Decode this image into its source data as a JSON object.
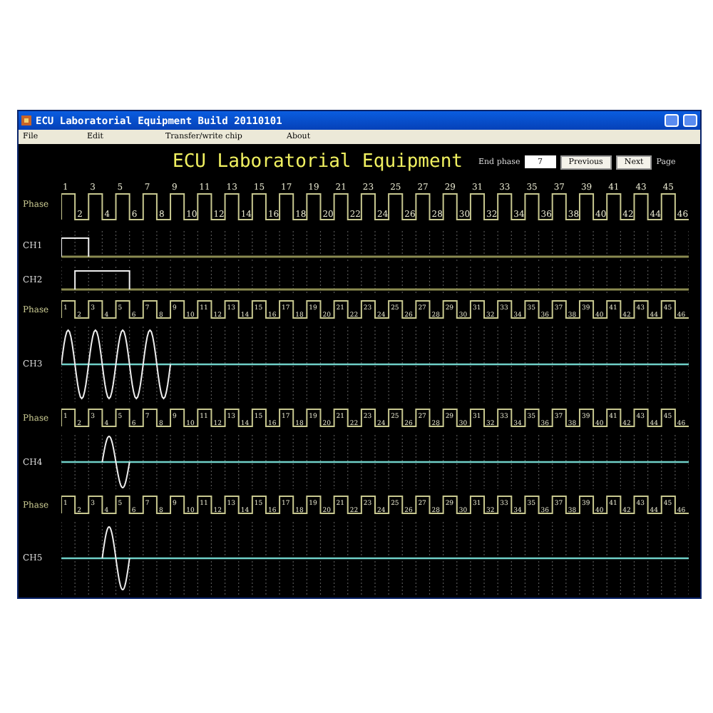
{
  "window": {
    "title": "ECU Laboratorial Equipment Build 20110101"
  },
  "menu": [
    "File",
    "Edit",
    "Transfer/write chip",
    "About"
  ],
  "header": {
    "title": "ECU Laboratorial Equipment",
    "end_phase_label": "End phase",
    "end_phase_value": "7",
    "buttons": [
      "Previous",
      "Next"
    ],
    "page_label": "Page"
  },
  "rows": [
    {
      "kind": "phase_tall",
      "label": "Phase",
      "numbers": [
        "1",
        "2",
        "3",
        "4",
        "5",
        "6",
        "7",
        "8",
        "9",
        "10",
        "11",
        "12",
        "13",
        "14",
        "15",
        "16",
        "17",
        "18",
        "19",
        "20",
        "21",
        "22",
        "23",
        "24",
        "25",
        "26",
        "27",
        "28",
        "29",
        "30",
        "31",
        "32",
        "33",
        "34",
        "35",
        "36",
        "37",
        "38",
        "39",
        "40",
        "41",
        "42",
        "43",
        "44",
        "45",
        "46"
      ]
    },
    {
      "kind": "pulse",
      "label": "CH1"
    },
    {
      "kind": "pulse",
      "label": "CH2"
    },
    {
      "kind": "phase",
      "label": "Phase",
      "numbers": [
        "1",
        "2",
        "3",
        "4",
        "5",
        "6",
        "7",
        "8",
        "9",
        "10",
        "11",
        "12",
        "13",
        "14",
        "15",
        "16",
        "17",
        "18",
        "19",
        "20",
        "21",
        "22",
        "23",
        "24",
        "25",
        "26",
        "27",
        "28",
        "29",
        "30",
        "31",
        "32",
        "33",
        "34",
        "35",
        "36",
        "37",
        "38",
        "39",
        "40",
        "41",
        "42",
        "43",
        "44",
        "45",
        "46"
      ]
    },
    {
      "kind": "sine",
      "label": "CH3"
    },
    {
      "kind": "phase",
      "label": "Phase",
      "numbers": [
        "1",
        "2",
        "3",
        "4",
        "5",
        "6",
        "7",
        "8",
        "9",
        "10",
        "11",
        "12",
        "13",
        "14",
        "15",
        "16",
        "17",
        "18",
        "19",
        "20",
        "21",
        "22",
        "23",
        "24",
        "25",
        "26",
        "27",
        "28",
        "29",
        "30",
        "31",
        "32",
        "33",
        "34",
        "35",
        "36",
        "37",
        "38",
        "39",
        "40",
        "41",
        "42",
        "43",
        "44",
        "45",
        "46"
      ]
    },
    {
      "kind": "sine",
      "label": "CH4"
    },
    {
      "kind": "phase",
      "label": "Phase",
      "numbers": [
        "1",
        "2",
        "3",
        "4",
        "5",
        "6",
        "7",
        "8",
        "9",
        "10",
        "11",
        "12",
        "13",
        "14",
        "15",
        "16",
        "17",
        "18",
        "19",
        "20",
        "21",
        "22",
        "23",
        "24",
        "25",
        "26",
        "27",
        "28",
        "29",
        "30",
        "31",
        "32",
        "33",
        "34",
        "35",
        "36",
        "37",
        "38",
        "39",
        "40",
        "41",
        "42",
        "43",
        "44",
        "45",
        "46"
      ]
    },
    {
      "kind": "sine",
      "label": "CH5"
    }
  ]
}
